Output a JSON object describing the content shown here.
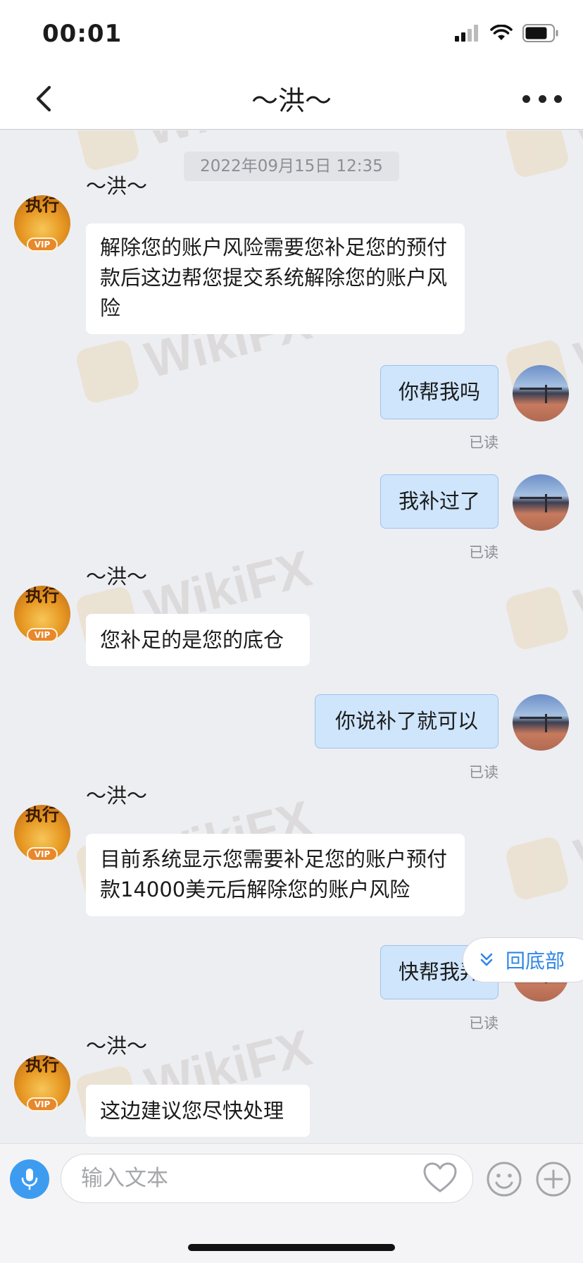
{
  "status_bar": {
    "time": "00:01"
  },
  "nav": {
    "title": "～洪～"
  },
  "chat": {
    "date": "2022年09月15日 12:35",
    "watermark": "WikiFX",
    "sender_name": "～洪～",
    "avatar_text": "执行",
    "vip_label": "VIP",
    "read_label": "已读",
    "messages": [
      {
        "dir": "in",
        "text": "解除您的账户风险需要您补足您的预付款后这边帮您提交系统解除您的账户风险"
      },
      {
        "dir": "out",
        "text": "你帮我吗"
      },
      {
        "dir": "out",
        "text": "我补过了"
      },
      {
        "dir": "in",
        "text": "您补足的是您的底仓"
      },
      {
        "dir": "out",
        "text": "你说补了就可以"
      },
      {
        "dir": "in",
        "text": "目前系统显示您需要补足您的账户预付款14000美元后解除您的账户风险"
      },
      {
        "dir": "out",
        "text": "快帮我弄"
      },
      {
        "dir": "in",
        "text": "这边建议您尽快处理"
      }
    ]
  },
  "scroll_button": {
    "label": "回底部"
  },
  "input": {
    "placeholder": "输入文本"
  },
  "icons": {
    "back": "chevron-left-icon",
    "more": "more-dots-icon",
    "mic": "microphone-icon",
    "heart": "heart-icon",
    "emoji": "smiley-icon",
    "plus": "plus-circle-icon",
    "scroll": "double-chevron-down-icon"
  },
  "colors": {
    "accent": "#2f86e6",
    "outgoing_bubble": "#cfe5fb",
    "background": "#edeef2"
  }
}
